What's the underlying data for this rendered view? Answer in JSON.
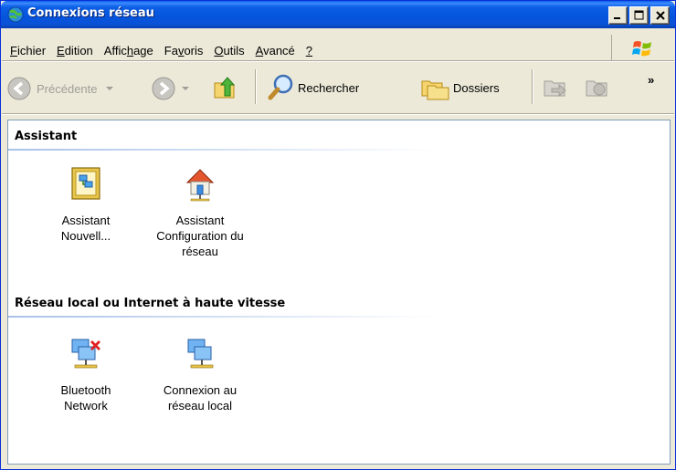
{
  "window": {
    "title": "Connexions réseau"
  },
  "menu": {
    "items": [
      {
        "label": "Fichier",
        "accel": "F"
      },
      {
        "label": "Edition",
        "accel": "E"
      },
      {
        "label": "Affichage",
        "accel": "h"
      },
      {
        "label": "Favoris",
        "accel": "v"
      },
      {
        "label": "Outils",
        "accel": "O"
      },
      {
        "label": "Avancé",
        "accel": "A"
      },
      {
        "label": "?",
        "accel": "?"
      }
    ]
  },
  "toolbar": {
    "back_label": "Précédente",
    "search_label": "Rechercher",
    "folders_label": "Dossiers",
    "more": "»"
  },
  "groups": [
    {
      "title": "Assistant",
      "items": [
        {
          "label_lines": [
            "Assistant",
            "Nouvell..."
          ],
          "icon": "new-connection-wizard-icon"
        },
        {
          "label_lines": [
            "Assistant",
            "Configuration du",
            "réseau"
          ],
          "icon": "home-network-wizard-icon"
        }
      ]
    },
    {
      "title": "Réseau local ou Internet à haute vitesse",
      "items": [
        {
          "label_lines": [
            "Bluetooth",
            "Network"
          ],
          "icon": "bluetooth-network-disconnected-icon"
        },
        {
          "label_lines": [
            "Connexion au",
            "réseau local"
          ],
          "icon": "local-area-connection-icon"
        }
      ]
    }
  ],
  "colors": {
    "titlebar": "#0554dc",
    "content_bg": "#ffffff",
    "chrome": "#ece9d8"
  }
}
